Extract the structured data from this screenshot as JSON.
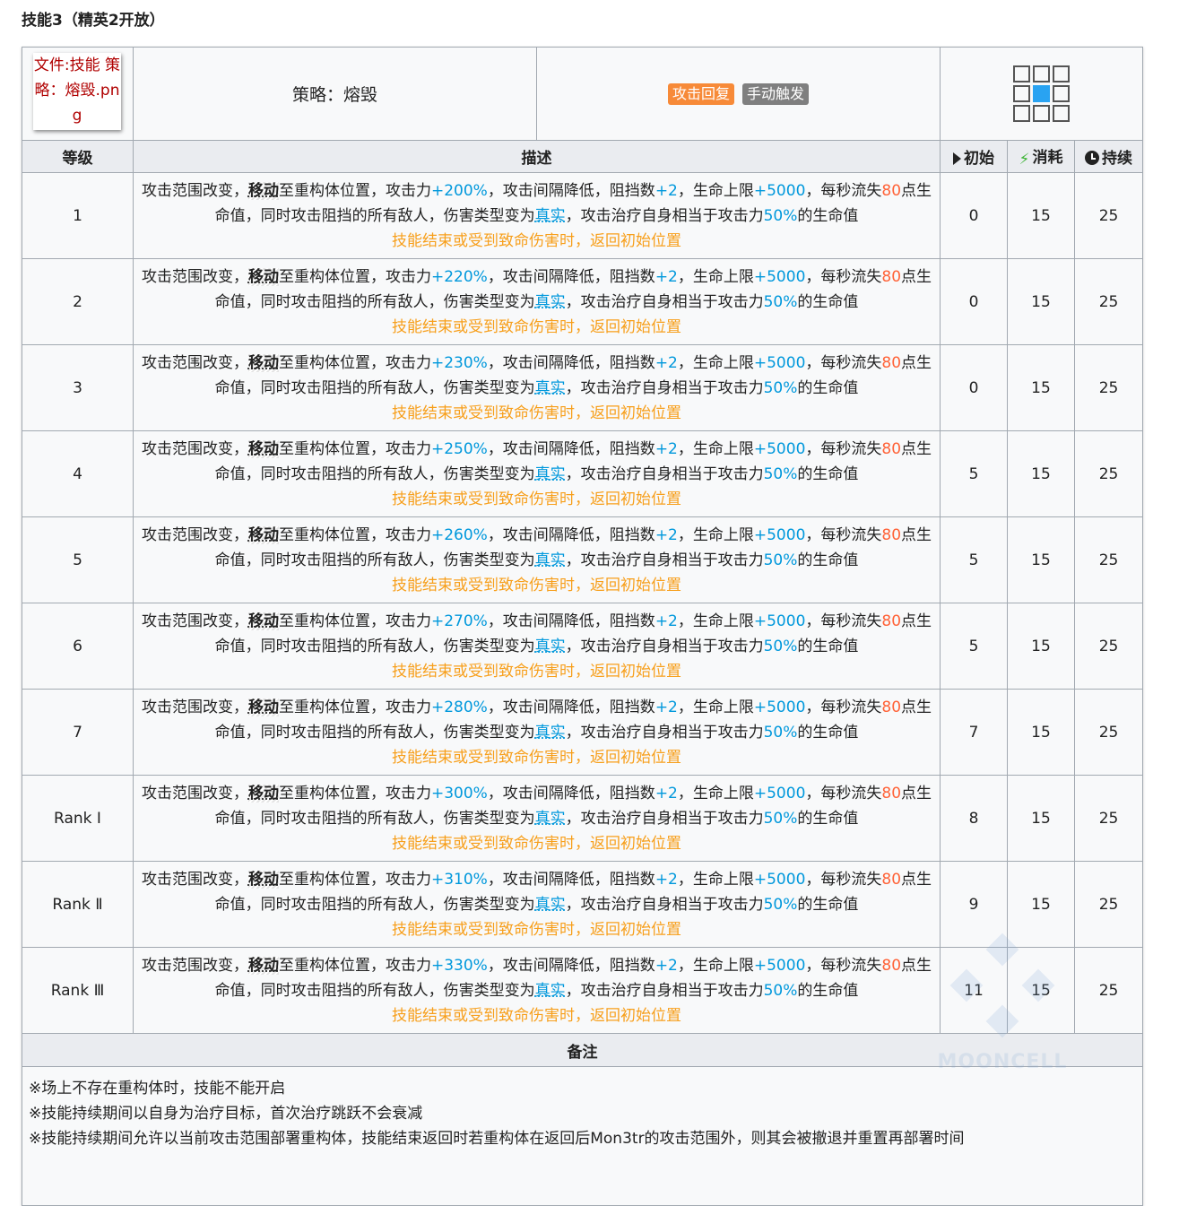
{
  "heading": "技能3（精英2开放）",
  "skill": {
    "image_alt": "文件:技能 策略：熔毁.png",
    "name": "策略：熔毁",
    "tags": [
      "攻击回复",
      "手动触发"
    ],
    "range_icon": "attack-range-grid-icon"
  },
  "columns": {
    "level": "等级",
    "desc": "描述",
    "initial": "初始",
    "cost": "消耗",
    "duration": "持续"
  },
  "desc_text": {
    "p1": "攻击范围改变，",
    "move": "移动",
    "p2": "至重构体位置，攻击力",
    "p3": "，攻击间隔降低，阻挡数",
    "block": "+2",
    "p4": "，生命上限",
    "hp": "+5000",
    "p5": "，每秒流失",
    "loss": "80",
    "p6": "点生命值，同时攻击阻挡的所有敌人，伤害类型变为",
    "true_dmg": "真实",
    "p7": "，攻击治疗自身相当于攻击力",
    "heal": "50%",
    "p8": "的生命值",
    "warn": "技能结束或受到致命伤害时，返回初始位置"
  },
  "rows": [
    {
      "level": "1",
      "atk": "+200%",
      "initial": "0",
      "cost": "15",
      "duration": "25"
    },
    {
      "level": "2",
      "atk": "+220%",
      "initial": "0",
      "cost": "15",
      "duration": "25"
    },
    {
      "level": "3",
      "atk": "+230%",
      "initial": "0",
      "cost": "15",
      "duration": "25"
    },
    {
      "level": "4",
      "atk": "+250%",
      "initial": "5",
      "cost": "15",
      "duration": "25"
    },
    {
      "level": "5",
      "atk": "+260%",
      "initial": "5",
      "cost": "15",
      "duration": "25"
    },
    {
      "level": "6",
      "atk": "+270%",
      "initial": "5",
      "cost": "15",
      "duration": "25"
    },
    {
      "level": "7",
      "atk": "+280%",
      "initial": "7",
      "cost": "15",
      "duration": "25"
    },
    {
      "level": "Rank Ⅰ",
      "atk": "+300%",
      "initial": "8",
      "cost": "15",
      "duration": "25"
    },
    {
      "level": "Rank Ⅱ",
      "atk": "+310%",
      "initial": "9",
      "cost": "15",
      "duration": "25"
    },
    {
      "level": "Rank Ⅲ",
      "atk": "+330%",
      "initial": "11",
      "cost": "15",
      "duration": "25"
    }
  ],
  "notes": {
    "title": "备注",
    "lines": [
      "※场上不存在重构体时，技能不能开启",
      "※技能持续期间以自身为治疗目标，首次治疗跳跃不会衰减",
      "※技能持续期间允许以当前攻击范围部署重构体，技能结束返回时若重构体在返回后Mon3tr的攻击范围外，则其会被撤退并重置再部署时间"
    ]
  },
  "watermark": "MOONCELL",
  "colors": {
    "highlight_blue": "#0098dc",
    "highlight_red": "#ff6237",
    "warning_orange": "#f79f1b",
    "tag_orange": "#f78a38",
    "tag_gray": "#7f7f7f",
    "range_active": "#29a3f2"
  }
}
